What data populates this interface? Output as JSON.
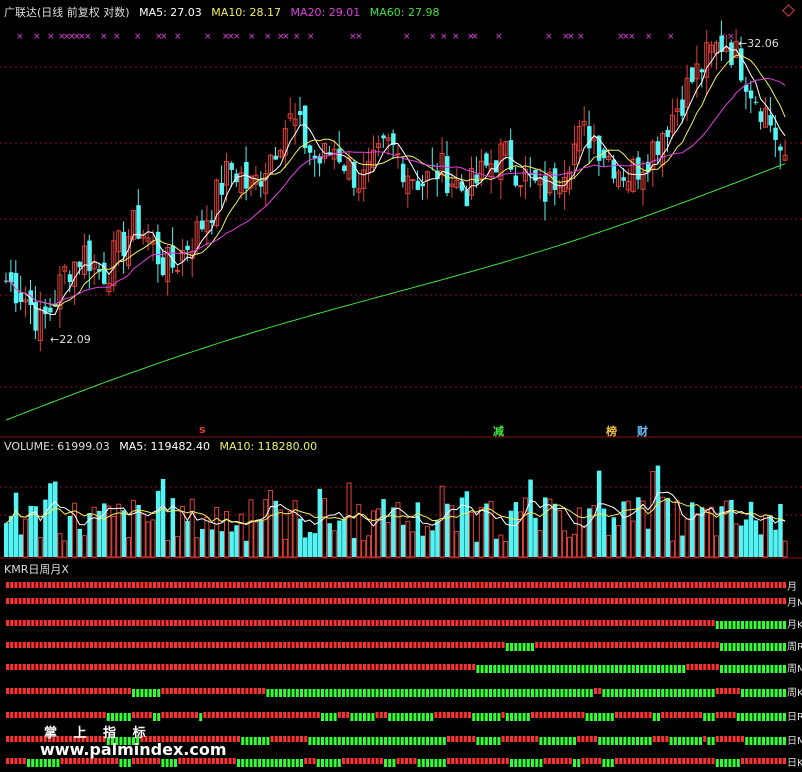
{
  "header": {
    "title": "广联达(日线 前复权 对数)",
    "ma5": "MA5: 27.03",
    "ma10": "MA10: 28.17",
    "ma20": "MA20: 29.01",
    "ma60": "MA60: 27.98"
  },
  "volume_header": {
    "volume": "VOLUME: 61999.03",
    "ma5": "MA5: 119482.40",
    "ma10": "MA10: 118280.00"
  },
  "kmr": {
    "title": "KMR日周月X",
    "row_labels": [
      "月",
      "月M",
      "月K",
      "周R",
      "周M",
      "周K",
      "日R",
      "日M",
      "日K"
    ]
  },
  "annotations": {
    "high_label": "32.06",
    "low_label": "22.09",
    "signal_s": "s",
    "signal_jian": "减",
    "signal_bang": "榜",
    "signal_cai": "财"
  },
  "watermark": {
    "text": "掌 上 指 标",
    "url": "www.palmindex.com"
  },
  "colors": {
    "background": "#000000",
    "up": "#e0403a",
    "down": "#54f4f4",
    "ma5": "#ffffff",
    "ma10": "#f0f060",
    "ma20": "#e040e0",
    "ma60": "#40e040",
    "kmr_red": "#ff3030",
    "kmr_green": "#30ff30",
    "grid": "#8b1010"
  },
  "chart_data": {
    "type": "candlestick",
    "price_min_shown": 22.09,
    "price_max_shown": 32.06,
    "close_path": [
      23.4,
      23.2,
      23.0,
      22.6,
      22.09,
      22.5,
      23.1,
      23.8,
      24.0,
      24.3,
      24.0,
      23.6,
      23.9,
      24.4,
      24.8,
      25.2,
      24.9,
      24.4,
      24.0,
      23.8,
      24.1,
      24.6,
      24.9,
      25.4,
      25.9,
      26.6,
      27.1,
      26.9,
      26.4,
      26.7,
      27.3,
      27.9,
      28.6,
      28.9,
      28.4,
      27.8,
      27.3,
      27.6,
      27.9,
      27.4,
      27.0,
      26.6,
      26.9,
      27.4,
      27.9,
      27.7,
      27.2,
      26.9,
      26.6,
      26.8,
      27.1,
      26.9,
      26.6,
      26.3,
      26.5,
      26.9,
      27.3,
      27.6,
      27.5,
      27.1,
      26.8,
      26.5,
      26.2,
      26.6,
      27.1,
      27.6,
      28.1,
      28.4,
      28.2,
      27.8,
      27.4,
      27.1,
      26.9,
      27.2,
      27.6,
      28.0,
      28.6,
      29.1,
      29.7,
      30.3,
      30.8,
      31.3,
      31.7,
      32.06,
      31.6,
      31.0,
      30.2,
      29.6,
      29.0,
      28.2,
      27.03
    ],
    "volume_value": 61999.03,
    "volume_ma5": 119482.4,
    "volume_ma10": 118280.0,
    "ma_values": {
      "MA5": 27.03,
      "MA10": 28.17,
      "MA20": 29.01,
      "MA60": 27.98
    }
  }
}
